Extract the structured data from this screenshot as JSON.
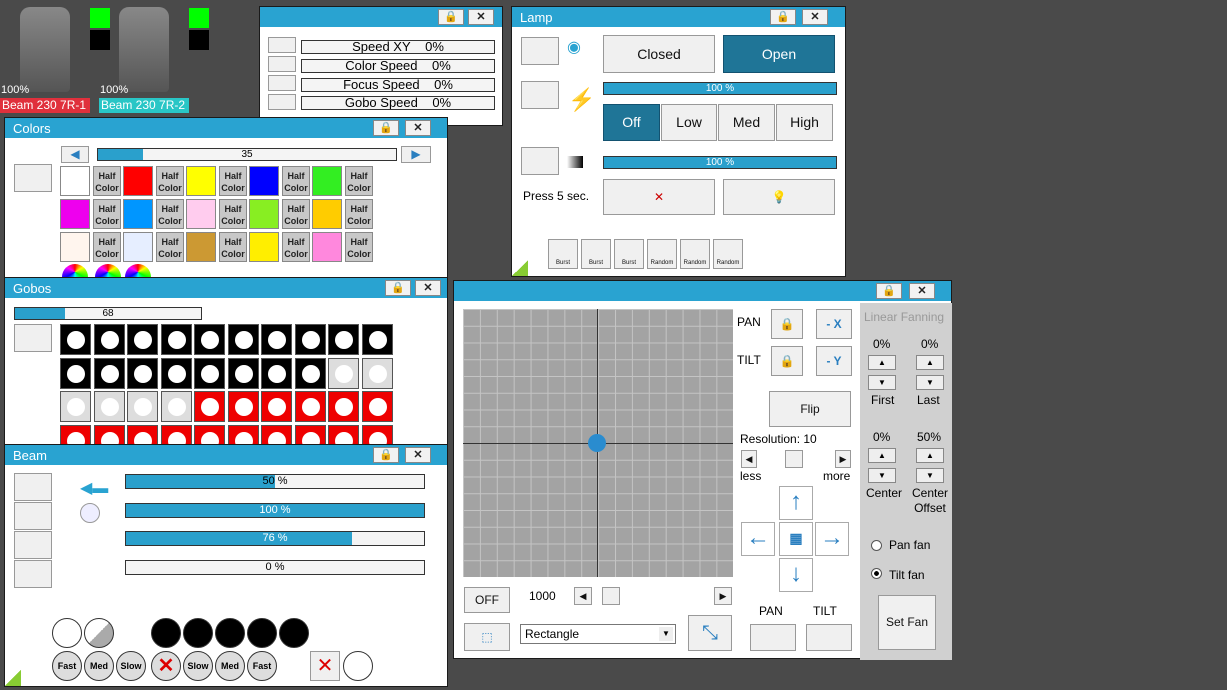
{
  "fixtures": [
    {
      "name": "Beam 230 7R-1",
      "level": "100%"
    },
    {
      "name": "Beam 230 7R-2",
      "level": "100%"
    }
  ],
  "speed": {
    "items": [
      {
        "label": "Speed XY",
        "value": "0%"
      },
      {
        "label": "Color Speed",
        "value": "0%"
      },
      {
        "label": "Focus Speed",
        "value": "0%"
      },
      {
        "label": "Gobo Speed",
        "value": "0%"
      }
    ]
  },
  "lamp": {
    "title": "Lamp",
    "closed": "Closed",
    "open": "Open",
    "bar1": "100 %",
    "off": "Off",
    "low": "Low",
    "med": "Med",
    "high": "High",
    "bar2": "100 %",
    "press": "Press 5 sec.",
    "effects": [
      "Burst",
      "Burst",
      "Burst",
      "Random",
      "Random",
      "Random"
    ]
  },
  "colors": {
    "title": "Colors",
    "slider": "35",
    "half": "Half Color",
    "swatches": [
      "#ffffff",
      "#ff0000",
      "#ffff00",
      "#0000ff",
      "#33ee22",
      "#ee00ee",
      "#0096ff",
      "#ffccee",
      "#88ee22",
      "#ffcc00",
      "#fff5ee",
      "#e6eeff",
      "#cc9933",
      "#ffee00",
      "#ff88dd"
    ]
  },
  "gobos": {
    "title": "Gobos",
    "slider": "68"
  },
  "beam": {
    "title": "Beam",
    "bars": [
      "50 %",
      "100 %",
      "76 %",
      "0 %"
    ],
    "speed_labels": [
      "Fast",
      "Med",
      "Slow",
      "",
      "Slow",
      "Med",
      "Fast"
    ]
  },
  "position": {
    "pan": "PAN",
    "tilt": "TILT",
    "minus_x": "- X",
    "minus_y": "- Y",
    "flip": "Flip",
    "resolution": "Resolution: 10",
    "less": "less",
    "more": "more",
    "off": "OFF",
    "value": "1000",
    "shape": "Rectangle",
    "pan2": "PAN",
    "tilt2": "TILT",
    "fan_title": "Linear Fanning",
    "first_pct": "0%",
    "last_pct": "0%",
    "first": "First",
    "last": "Last",
    "center_pct": "0%",
    "offset_pct": "50%",
    "center": "Center",
    "center_offset": "Center Offset",
    "pan_fan": "Pan fan",
    "tilt_fan": "Tilt fan",
    "set_fan": "Set Fan"
  },
  "progress": {
    "beam_bars": [
      0.5,
      1.0,
      0.76,
      0.0
    ],
    "lamp_bars": [
      1.0,
      1.0
    ],
    "colors_slider": 0.15,
    "gobos_slider": 0.27
  }
}
